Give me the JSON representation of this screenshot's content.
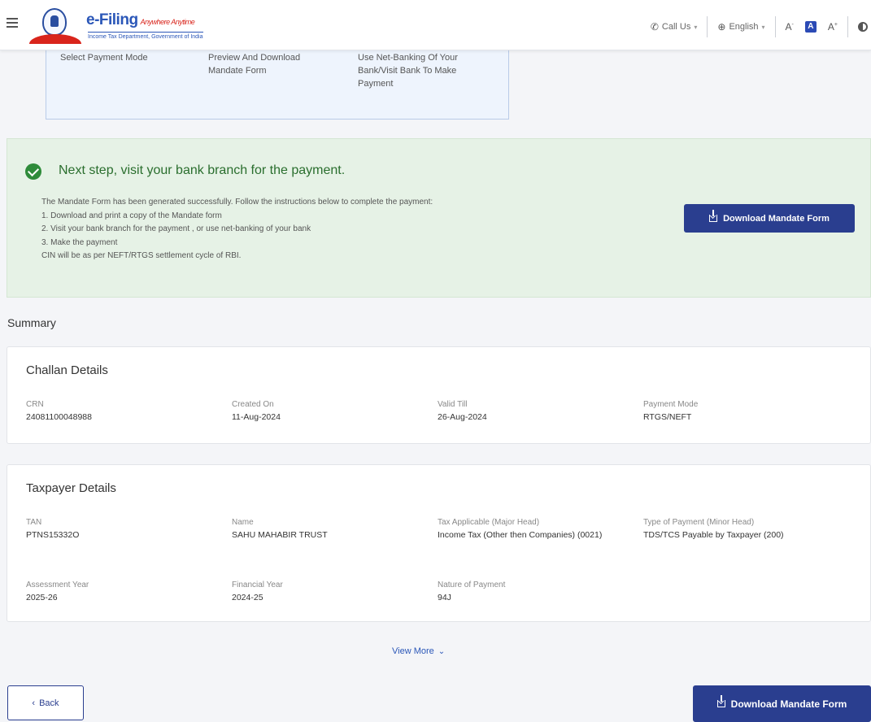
{
  "header": {
    "logo_title": "e-Filing",
    "logo_tagline": "Anywhere Anytime",
    "logo_subtitle": "Income Tax Department, Government of India",
    "call_us": "Call Us",
    "language": "English",
    "font_decrease": "A-",
    "font_default": "A",
    "font_increase": "A+"
  },
  "steps": [
    {
      "label": "Select Payment Mode"
    },
    {
      "label": "Preview And Download Mandate Form"
    },
    {
      "label": "Use Net-Banking Of Your Bank/Visit Bank To Make Payment"
    }
  ],
  "success": {
    "title": "Next step, visit your bank branch for the payment.",
    "lines": [
      "The Mandate Form has been generated successfully. Follow the instructions below to complete the payment:",
      "1. Download and print a copy of the Mandate form",
      "2. Visit your bank branch for the payment , or use net-banking of your bank",
      "3. Make the payment",
      "CIN will be as per NEFT/RTGS settlement cycle of RBI."
    ],
    "button_label": "Download Mandate Form"
  },
  "summary": {
    "heading": "Summary",
    "challan": {
      "title": "Challan Details",
      "fields": [
        {
          "label": "CRN",
          "value": "24081100048988"
        },
        {
          "label": "Created On",
          "value": "11-Aug-2024"
        },
        {
          "label": "Valid Till",
          "value": "26-Aug-2024"
        },
        {
          "label": "Payment Mode",
          "value": "RTGS/NEFT"
        }
      ]
    },
    "taxpayer": {
      "title": "Taxpayer Details",
      "fields": [
        {
          "label": "TAN",
          "value": "PTNS15332O"
        },
        {
          "label": "Name",
          "value": "SAHU MAHABIR TRUST"
        },
        {
          "label": "Tax Applicable (Major Head)",
          "value": "Income Tax (Other then Companies) (0021)"
        },
        {
          "label": "Type of Payment (Minor Head)",
          "value": "TDS/TCS Payable by Taxpayer (200)"
        },
        {
          "label": "Assessment Year",
          "value": "2025-26"
        },
        {
          "label": "Financial Year",
          "value": "2024-25"
        },
        {
          "label": "Nature of Payment",
          "value": "94J"
        }
      ]
    }
  },
  "view_more": "View More",
  "back_label": "Back",
  "bottom_button_label": "Download Mandate Form",
  "colors": {
    "primary": "#2a3e8f",
    "success_bg": "#e6f2e6",
    "success_text": "#2a6e2e",
    "link": "#2b57b8"
  }
}
